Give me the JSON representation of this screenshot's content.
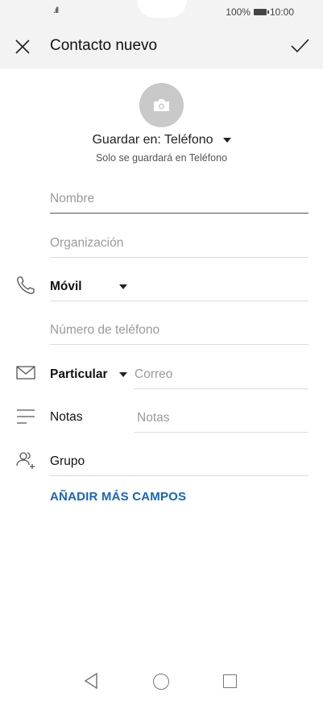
{
  "status_bar": {
    "battery": "100%",
    "time": "10:00"
  },
  "app_bar": {
    "title": "Contacto nuevo"
  },
  "save_to": {
    "label": "Guardar en: Teléfono",
    "note": "Solo se guardará en Teléfono"
  },
  "fields": {
    "name_placeholder": "Nombre",
    "org_placeholder": "Organización",
    "phone_type": "Móvil",
    "phone_placeholder": "Número de teléfono",
    "email_type": "Particular",
    "email_placeholder": "Correo",
    "notes_label": "Notas",
    "notes_placeholder": "Notas",
    "group_label": "Grupo"
  },
  "add_more": "AÑADIR MÁS CAMPOS",
  "colors": {
    "accent": "#1565c0",
    "app_bar_bg": "#f3f3f3"
  }
}
